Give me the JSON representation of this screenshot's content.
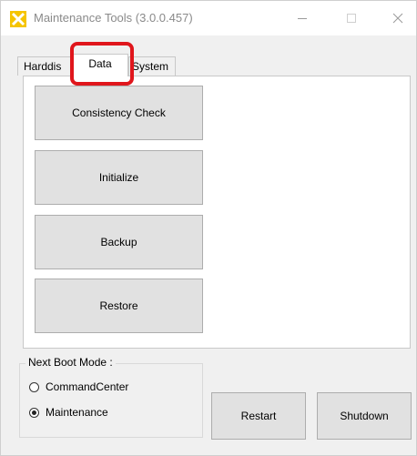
{
  "window": {
    "title": "Maintenance Tools (3.0.0.457)",
    "icon": "yellow-x-logo-icon",
    "controls": [
      "minimize-icon",
      "maximize-icon",
      "close-icon"
    ]
  },
  "tabs": [
    {
      "label": "Harddis",
      "selected": false
    },
    {
      "label": "Data",
      "selected": true
    },
    {
      "label": "System",
      "selected": false
    }
  ],
  "data_panel": {
    "buttons": [
      "Consistency Check",
      "Initialize",
      "Backup",
      "Restore"
    ]
  },
  "boot_mode": {
    "label": "Next Boot Mode :",
    "options": [
      {
        "label": "CommandCenter",
        "checked": false
      },
      {
        "label": "Maintenance",
        "checked": true
      }
    ]
  },
  "actions": {
    "restart": "Restart",
    "shutdown": "Shutdown"
  },
  "colors": {
    "highlight": "#e0161c",
    "logo": "#f5c400"
  }
}
